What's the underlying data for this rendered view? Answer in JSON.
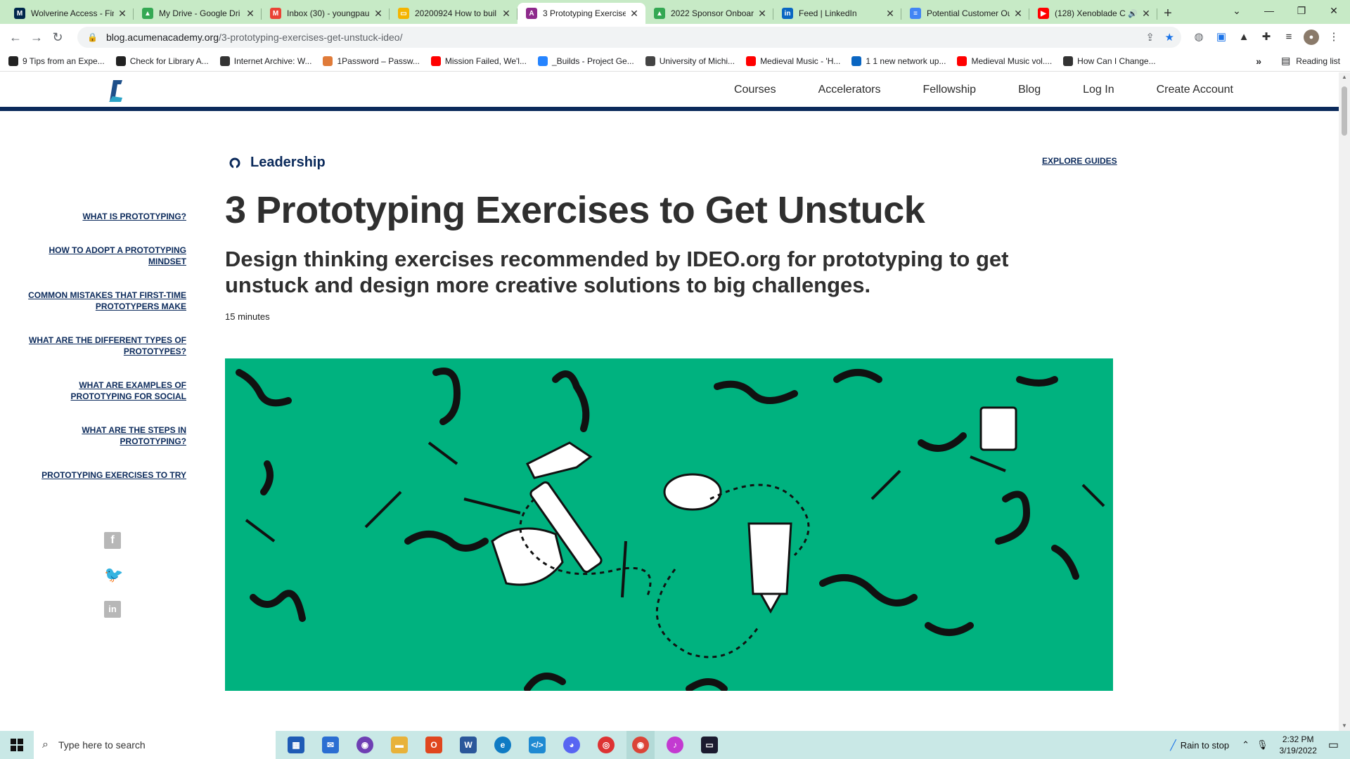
{
  "browser": {
    "tabs": [
      {
        "title": "Wolverine Access - Fin",
        "icon": "umich-icon",
        "color": "#00274c",
        "glyph": "M",
        "active": false
      },
      {
        "title": "My Drive - Google Dri",
        "icon": "google-drive-icon",
        "color": "#34a853",
        "glyph": "▲",
        "active": false
      },
      {
        "title": "Inbox (30) - youngpau",
        "icon": "gmail-icon",
        "color": "#ea4335",
        "glyph": "M",
        "active": false
      },
      {
        "title": "20200924 How to buil",
        "icon": "google-slides-icon",
        "color": "#f4b400",
        "glyph": "▭",
        "active": false
      },
      {
        "title": "3 Prototyping Exercise",
        "icon": "acumen-icon",
        "color": "#8e2a8c",
        "glyph": "A",
        "active": true
      },
      {
        "title": "2022 Sponsor Onboar",
        "icon": "google-drive-icon",
        "color": "#34a853",
        "glyph": "▲",
        "active": false
      },
      {
        "title": "Feed | LinkedIn",
        "icon": "linkedin-icon",
        "color": "#0a66c2",
        "glyph": "in",
        "active": false
      },
      {
        "title": "Potential Customer Ou",
        "icon": "google-docs-icon",
        "color": "#4285f4",
        "glyph": "≡",
        "active": false
      },
      {
        "title": "(128) Xenoblade C",
        "icon": "youtube-icon",
        "color": "#ff0000",
        "glyph": "▶",
        "active": false,
        "audio": true
      }
    ],
    "url_host": "blog.acumenacademy.org",
    "url_path": "/3-prototyping-exercises-get-unstuck-ideo/",
    "bookmarks": [
      {
        "label": "9 Tips from an Expe...",
        "icon": "bookmark-icon-1",
        "color": "#222"
      },
      {
        "label": "Check for Library A...",
        "icon": "library-icon",
        "color": "#222"
      },
      {
        "label": "Internet Archive: W...",
        "icon": "archive-icon",
        "color": "#333"
      },
      {
        "label": "1Password – Passw...",
        "icon": "onepassword-icon",
        "color": "#e07b39"
      },
      {
        "label": "Mission Failed, We'l...",
        "icon": "youtube-icon",
        "color": "#ff0000"
      },
      {
        "label": "_Builds - Project Ge...",
        "icon": "jira-icon",
        "color": "#2684ff"
      },
      {
        "label": "University of Michi...",
        "icon": "umich-cube-icon",
        "color": "#444"
      },
      {
        "label": "Medieval Music - 'H...",
        "icon": "youtube-icon",
        "color": "#ff0000"
      },
      {
        "label": "1 1 new network up...",
        "icon": "linkedin-icon",
        "color": "#0a66c2"
      },
      {
        "label": "Medieval Music vol....",
        "icon": "youtube-icon",
        "color": "#ff0000"
      },
      {
        "label": "How Can I Change...",
        "icon": "wordpress-icon",
        "color": "#333"
      }
    ],
    "reading_list": "Reading list"
  },
  "site": {
    "nav": [
      "Courses",
      "Accelerators",
      "Fellowship",
      "Blog",
      "Log In",
      "Create Account"
    ],
    "brand_color": "#0b2a5b"
  },
  "toc": [
    "WHAT IS PROTOTYPING?",
    "HOW TO ADOPT A PROTOTYPING MINDSET",
    "COMMON MISTAKES THAT FIRST-TIME PROTOTYPERS MAKE",
    "WHAT ARE THE DIFFERENT TYPES OF PROTOTYPES?",
    "WHAT ARE EXAMPLES OF PROTOTYPING FOR SOCIAL",
    "WHAT ARE THE STEPS IN PROTOTYPING?",
    "PROTOTYPING EXERCISES TO TRY"
  ],
  "article": {
    "category": "Leadership",
    "explore": "EXPLORE GUIDES",
    "title": "3 Prototyping Exercises to Get Unstuck",
    "subtitle": "Design thinking exercises recommended by IDEO.org for prototyping to get unstuck and design more creative solutions to big challenges.",
    "read_time": "15 minutes",
    "hero_color": "#00b27f"
  },
  "taskbar": {
    "search_placeholder": "Type here to search",
    "weather": "Rain to stop",
    "time": "2:32 PM",
    "date": "3/19/2022"
  }
}
